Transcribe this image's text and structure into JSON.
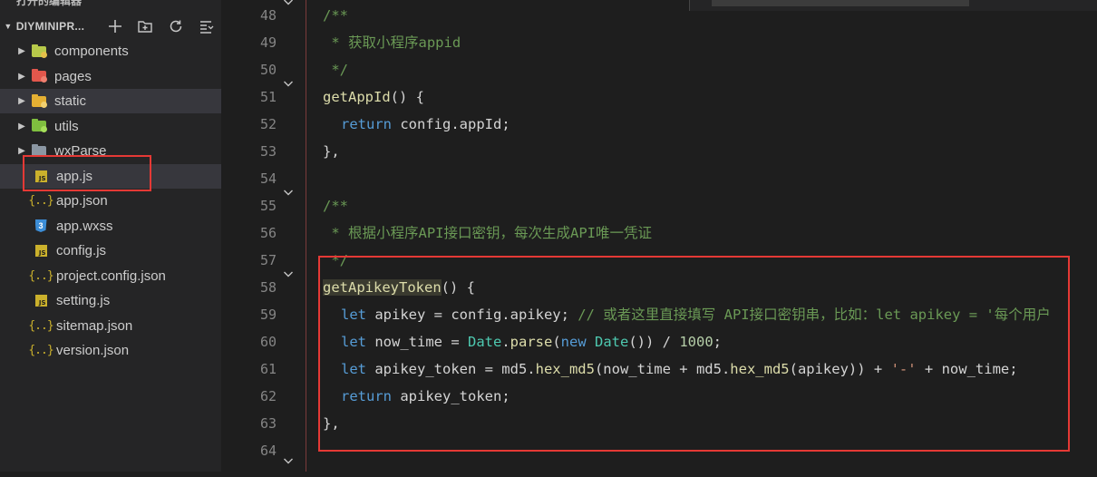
{
  "sidebar": {
    "open_editors_label": "打开的编辑器",
    "project_name": "DIYMINIPR...",
    "tree": [
      {
        "label": "components",
        "kind": "folder",
        "icon": "folder-components-icon",
        "color": "#b7c94a",
        "dot": "#e5c04a"
      },
      {
        "label": "pages",
        "kind": "folder",
        "icon": "folder-pages-icon",
        "color": "#e2574c",
        "dot": "#f08070"
      },
      {
        "label": "static",
        "kind": "folder",
        "icon": "folder-static-icon",
        "color": "#e5b033",
        "dot": "#f2d070"
      },
      {
        "label": "utils",
        "kind": "folder",
        "icon": "folder-utils-icon",
        "color": "#7fbf3f",
        "dot": "#a6e05a"
      },
      {
        "label": "wxParse",
        "kind": "folder",
        "icon": "folder-icon",
        "color": "#8b97a3",
        "dot": ""
      },
      {
        "label": "app.js",
        "kind": "file",
        "icon": "js-file-icon"
      },
      {
        "label": "app.json",
        "kind": "file",
        "icon": "json-file-icon"
      },
      {
        "label": "app.wxss",
        "kind": "file",
        "icon": "css-file-icon"
      },
      {
        "label": "config.js",
        "kind": "file",
        "icon": "js-file-icon"
      },
      {
        "label": "project.config.json",
        "kind": "file",
        "icon": "json-file-icon"
      },
      {
        "label": "setting.js",
        "kind": "file",
        "icon": "js-file-icon"
      },
      {
        "label": "sitemap.json",
        "kind": "file",
        "icon": "json-file-icon"
      },
      {
        "label": "version.json",
        "kind": "file",
        "icon": "json-file-icon"
      }
    ],
    "js_icon_text": "JS",
    "json_icon_text": "{..}",
    "css_icon_text": "3"
  },
  "editor": {
    "line_numbers": [
      "48",
      "49",
      "50",
      "51",
      "52",
      "53",
      "54",
      "55",
      "56",
      "57",
      "58",
      "59",
      "60",
      "61",
      "62",
      "63",
      "64"
    ],
    "code": {
      "l48": "/**",
      "l49": " * 获取小程序appid",
      "l50": " */",
      "l51_fn": "getAppId",
      "l51_rest": "() {",
      "l52_kw": "return",
      "l52_rest": " config.appId;",
      "l53": "},",
      "l55": "/**",
      "l56": " * 根据小程序API接口密钥，每次生成API唯一凭证",
      "l57": " */",
      "l58_fn": "getApikeyToken",
      "l58_rest": "() {",
      "l59_kw": "let",
      "l59_a": " apikey = config.apikey; ",
      "l59_cmt": "// 或者这里直接填写 API接口密钥串，比如：let apikey = '每个用户",
      "l60_kw": "let",
      "l60_a": " now_time = ",
      "l60_cls": "Date",
      "l60_b": ".",
      "l60_fn": "parse",
      "l60_c": "(",
      "l60_kw2": "new",
      "l60_d": " ",
      "l60_cls2": "Date",
      "l60_e": "()) / ",
      "l60_num": "1000",
      "l60_f": ";",
      "l61_kw": "let",
      "l61_a": " apikey_token = md5.",
      "l61_fn": "hex_md5",
      "l61_b": "(now_time + md5.",
      "l61_fn2": "hex_md5",
      "l61_c": "(apikey)) + ",
      "l61_str": "'-'",
      "l61_d": " + now_time;",
      "l62_kw": "return",
      "l62_rest": " apikey_token;",
      "l63": "},"
    }
  },
  "colors": {
    "highlight_box": "#e53935",
    "background": "#1e1e1e",
    "sidebar_bg": "#252526"
  }
}
